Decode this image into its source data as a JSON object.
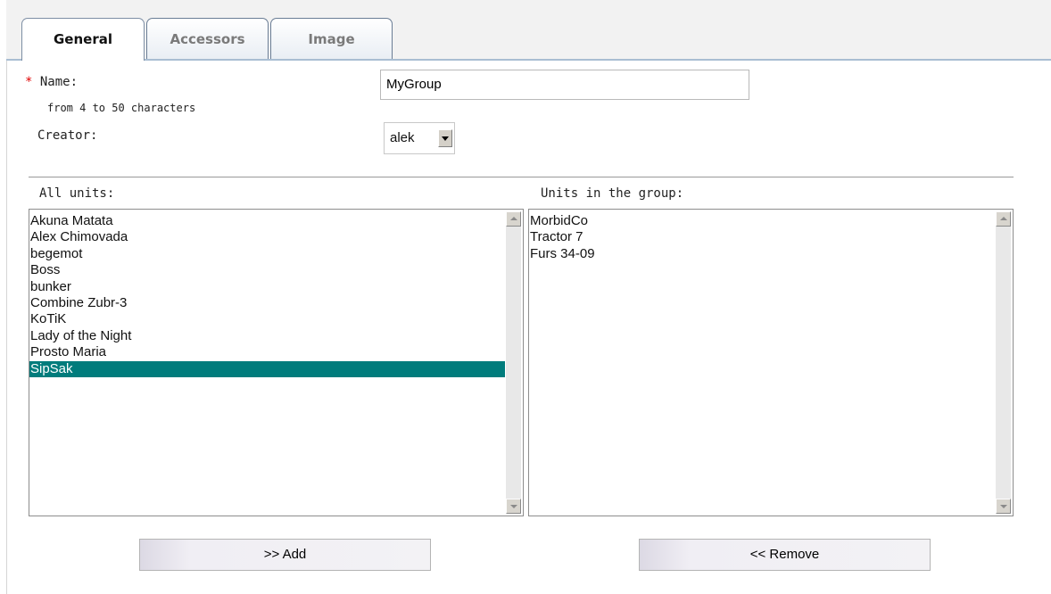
{
  "tabs": [
    {
      "label": "General",
      "active": true
    },
    {
      "label": "Accessors",
      "active": false
    },
    {
      "label": "Image",
      "active": false
    }
  ],
  "form": {
    "required_marker": "*",
    "name_label": "Name:",
    "name_hint": "from 4 to 50 characters",
    "name_value": "MyGroup",
    "creator_label": "Creator:",
    "creator_value": "alek"
  },
  "all_units": {
    "label": "All units:",
    "items": [
      "Akuna Matata",
      "Alex Chimovada",
      "begemot",
      "Boss",
      "bunker",
      "Combine Zubr-3",
      "KoTiK",
      "Lady of the Night",
      "Prosto Maria",
      "SipSak"
    ],
    "selected": "SipSak"
  },
  "group_units": {
    "label": "Units in the group:",
    "items": [
      "MorbidCo",
      "Tractor 7",
      "Furs 34-09"
    ]
  },
  "buttons": {
    "add": ">> Add",
    "remove": "<< Remove"
  },
  "colors": {
    "selection": "#007c7c",
    "required": "#e00000",
    "tab_border": "#6a7d95"
  },
  "icons": {
    "dropdown": "chevron-down-icon",
    "scroll_up": "scroll-up-arrow-icon",
    "scroll_down": "scroll-down-arrow-icon"
  }
}
